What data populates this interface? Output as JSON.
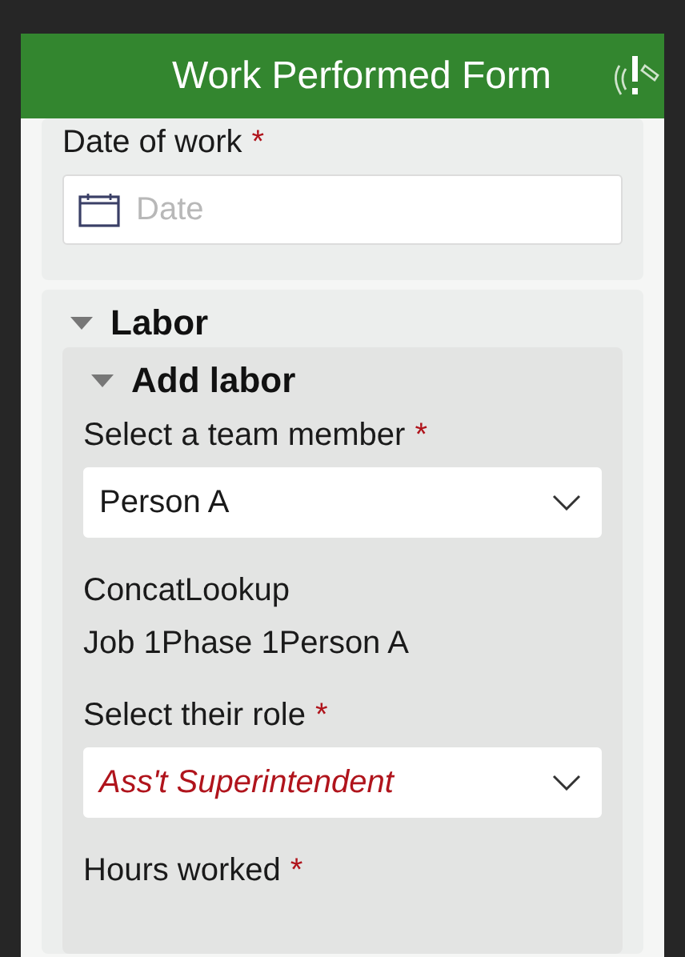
{
  "header": {
    "title": "Work Performed Form"
  },
  "fields": [
    {
      "kind": "date",
      "label": "Date of work",
      "required_mark": "*",
      "placeholder": "Date"
    }
  ],
  "groups": [
    {
      "title": "Labor",
      "expanded": true,
      "children": [
        {
          "title": "Add labor",
          "expanded": true,
          "fields": [
            {
              "kind": "select",
              "label": "Select a team member",
              "required_mark": "*",
              "value": "Person A",
              "invalid": false
            },
            {
              "kind": "readonly",
              "label": "ConcatLookup",
              "value": "Job 1Phase 1Person A"
            },
            {
              "kind": "select",
              "label": "Select their role",
              "required_mark": "*",
              "value": "Ass't Superintendent",
              "invalid": true
            },
            {
              "kind": "number",
              "label": "Hours worked",
              "required_mark": "*"
            }
          ]
        }
      ]
    }
  ]
}
